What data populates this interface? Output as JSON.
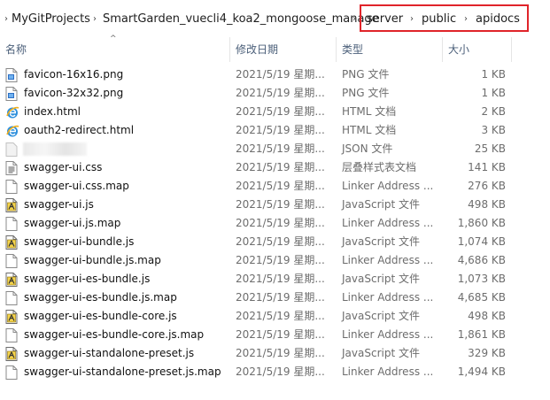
{
  "breadcrumb": {
    "items": [
      "MyGitProjects",
      "SmartGarden_vuecli4_koa2_mongoose_manage",
      "server",
      "public",
      "apidocs"
    ]
  },
  "columns": {
    "name": "名称",
    "date": "修改日期",
    "type": "类型",
    "size": "大小"
  },
  "highlight_color": "#e0242a",
  "files": [
    {
      "name": "favicon-16x16.png",
      "date": "2021/5/19 星期...",
      "type": "PNG 文件",
      "size": "1 KB",
      "icon": "png-file-icon"
    },
    {
      "name": "favicon-32x32.png",
      "date": "2021/5/19 星期...",
      "type": "PNG 文件",
      "size": "1 KB",
      "icon": "png-file-icon"
    },
    {
      "name": "index.html",
      "date": "2021/5/19 星期...",
      "type": "HTML 文档",
      "size": "2 KB",
      "icon": "ie-html-icon"
    },
    {
      "name": "oauth2-redirect.html",
      "date": "2021/5/19 星期...",
      "type": "HTML 文档",
      "size": "3 KB",
      "icon": "ie-html-icon"
    },
    {
      "name": "",
      "date": "2021/5/19 星期...",
      "type": "JSON 文件",
      "size": "25 KB",
      "icon": "json-file-icon",
      "blurred": true
    },
    {
      "name": "swagger-ui.css",
      "date": "2021/5/19 星期...",
      "type": "层叠样式表文档",
      "size": "141 KB",
      "icon": "css-file-icon"
    },
    {
      "name": "swagger-ui.css.map",
      "date": "2021/5/19 星期...",
      "type": "Linker Address ...",
      "size": "276 KB",
      "icon": "map-file-icon"
    },
    {
      "name": "swagger-ui.js",
      "date": "2021/5/19 星期...",
      "type": "JavaScript 文件",
      "size": "498 KB",
      "icon": "js-file-icon"
    },
    {
      "name": "swagger-ui.js.map",
      "date": "2021/5/19 星期...",
      "type": "Linker Address ...",
      "size": "1,860 KB",
      "icon": "map-file-icon"
    },
    {
      "name": "swagger-ui-bundle.js",
      "date": "2021/5/19 星期...",
      "type": "JavaScript 文件",
      "size": "1,074 KB",
      "icon": "js-file-icon"
    },
    {
      "name": "swagger-ui-bundle.js.map",
      "date": "2021/5/19 星期...",
      "type": "Linker Address ...",
      "size": "4,686 KB",
      "icon": "map-file-icon"
    },
    {
      "name": "swagger-ui-es-bundle.js",
      "date": "2021/5/19 星期...",
      "type": "JavaScript 文件",
      "size": "1,073 KB",
      "icon": "js-file-icon"
    },
    {
      "name": "swagger-ui-es-bundle.js.map",
      "date": "2021/5/19 星期...",
      "type": "Linker Address ...",
      "size": "4,685 KB",
      "icon": "map-file-icon"
    },
    {
      "name": "swagger-ui-es-bundle-core.js",
      "date": "2021/5/19 星期...",
      "type": "JavaScript 文件",
      "size": "498 KB",
      "icon": "js-file-icon"
    },
    {
      "name": "swagger-ui-es-bundle-core.js.map",
      "date": "2021/5/19 星期...",
      "type": "Linker Address ...",
      "size": "1,861 KB",
      "icon": "map-file-icon"
    },
    {
      "name": "swagger-ui-standalone-preset.js",
      "date": "2021/5/19 星期...",
      "type": "JavaScript 文件",
      "size": "329 KB",
      "icon": "js-file-icon"
    },
    {
      "name": "swagger-ui-standalone-preset.js.map",
      "date": "2021/5/19 星期...",
      "type": "Linker Address ...",
      "size": "1,494 KB",
      "icon": "map-file-icon"
    }
  ]
}
